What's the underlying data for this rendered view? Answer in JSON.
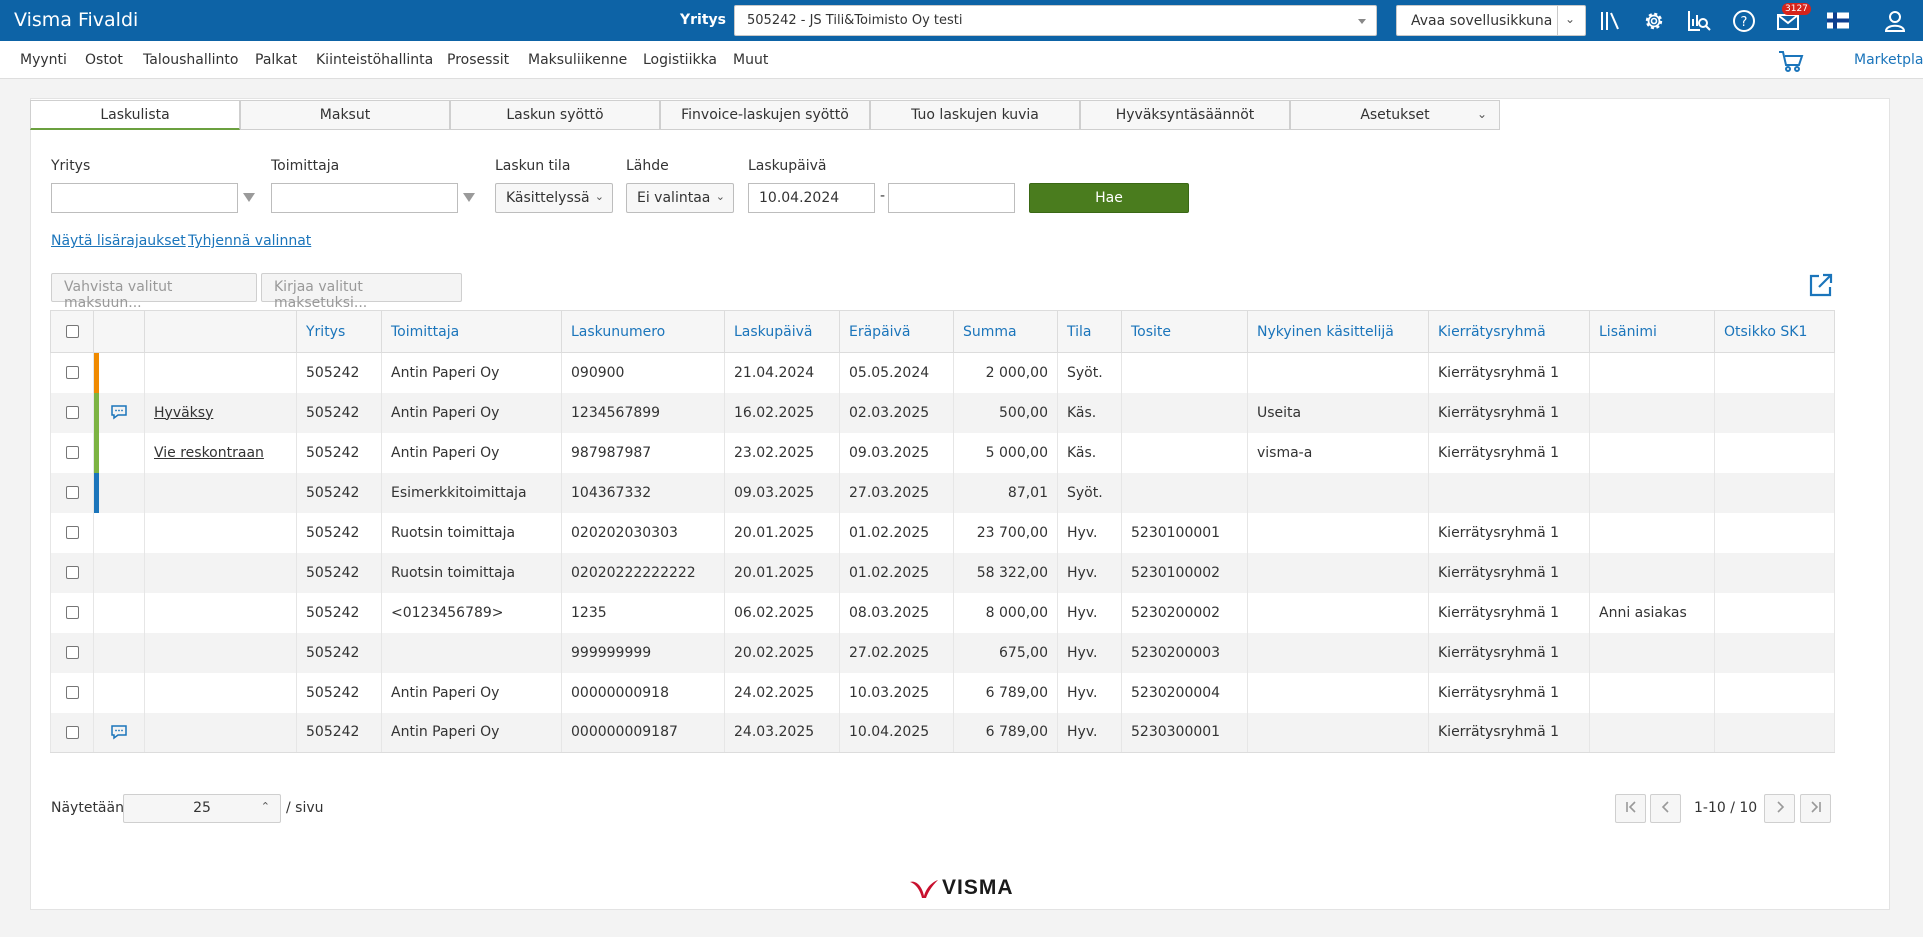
{
  "app": {
    "brand": "Visma Fivaldi",
    "company_label": "Yritys",
    "company_value": "505242 - JS Tili&Toimisto Oy testi",
    "open_app_label": "Avaa sovellusikkuna",
    "mail_count": "3127",
    "accent_color": "#0d63a6"
  },
  "menu": {
    "items": [
      "Myynti",
      "Ostot",
      "Taloushallinto",
      "Palkat",
      "Kiinteistöhallinta",
      "Prosessit",
      "Maksuliikenne",
      "Logistiikka",
      "Muut"
    ],
    "marketplace": "Marketplace"
  },
  "tabs": [
    "Laskulista",
    "Maksut",
    "Laskun syöttö",
    "Finvoice-laskujen syöttö",
    "Tuo laskujen kuvia",
    "Hyväksyntäsäännöt",
    "Asetukset"
  ],
  "filters": {
    "yritys_label": "Yritys",
    "yritys_value": "",
    "toimittaja_label": "Toimittaja",
    "toimittaja_value": "",
    "tila_label": "Laskun tila",
    "tila_value": "Käsittelyssä",
    "lahde_label": "Lähde",
    "lahde_value": "Ei valintaa",
    "laskupaiva_label": "Laskupäivä",
    "date_from": "10.04.2024",
    "date_sep": "-",
    "date_to": "",
    "search_button": "Hae",
    "more_limits": "Näytä lisärajaukset",
    "clear_selections": "Tyhjennä valinnat"
  },
  "actions": {
    "confirm_payment": "Vahvista valitut maksuun...",
    "record_payment": "Kirjaa valitut maksetuksi..."
  },
  "table": {
    "columns": [
      "Yritys",
      "Toimittaja",
      "Laskunumero",
      "Laskupäivä",
      "Eräpäivä",
      "Summa",
      "Tila",
      "Tosite",
      "Nykyinen käsittelijä",
      "Kierrätysryhmä",
      "Lisänimi",
      "Otsikko SK1"
    ],
    "rows": [
      {
        "status_color": "#f08a00",
        "comment": false,
        "action": "",
        "cells": [
          "505242",
          "Antin Paperi Oy",
          "090900",
          "21.04.2024",
          "05.05.2024",
          "2 000,00",
          "Syöt.",
          "",
          "",
          "Kierrätysryhmä 1",
          "",
          ""
        ]
      },
      {
        "status_color": "#7cb342",
        "comment": true,
        "action": "Hyväksy",
        "cells": [
          "505242",
          "Antin Paperi Oy",
          "1234567899",
          "16.02.2025",
          "02.03.2025",
          "500,00",
          "Käs.",
          "",
          "Useita",
          "Kierrätysryhmä 1",
          "",
          ""
        ]
      },
      {
        "status_color": "#7cb342",
        "comment": false,
        "action": "Vie reskontraan",
        "cells": [
          "505242",
          "Antin Paperi Oy",
          "987987987",
          "23.02.2025",
          "09.03.2025",
          "5 000,00",
          "Käs.",
          "",
          "visma-a",
          "Kierrätysryhmä 1",
          "",
          ""
        ]
      },
      {
        "status_color": "#1b75bb",
        "comment": false,
        "action": "",
        "cells": [
          "505242",
          "Esimerkkitoimittaja",
          "104367332",
          "09.03.2025",
          "27.03.2025",
          "87,01",
          "Syöt.",
          "",
          "",
          "",
          "",
          ""
        ]
      },
      {
        "status_color": "",
        "comment": false,
        "action": "",
        "cells": [
          "505242",
          "Ruotsin toimittaja",
          "020202030303",
          "20.01.2025",
          "01.02.2025",
          "23 700,00",
          "Hyv.",
          "5230100001",
          "",
          "Kierrätysryhmä 1",
          "",
          ""
        ]
      },
      {
        "status_color": "",
        "comment": false,
        "action": "",
        "cells": [
          "505242",
          "Ruotsin toimittaja",
          "02020222222222",
          "20.01.2025",
          "01.02.2025",
          "58 322,00",
          "Hyv.",
          "5230100002",
          "",
          "Kierrätysryhmä 1",
          "",
          ""
        ]
      },
      {
        "status_color": "",
        "comment": false,
        "action": "",
        "cells": [
          "505242",
          "<0123456789>",
          "1235",
          "06.02.2025",
          "08.03.2025",
          "8 000,00",
          "Hyv.",
          "5230200002",
          "",
          "Kierrätysryhmä 1",
          "Anni asiakas",
          ""
        ]
      },
      {
        "status_color": "",
        "comment": false,
        "action": "",
        "cells": [
          "505242",
          "",
          "999999999",
          "20.02.2025",
          "27.02.2025",
          "675,00",
          "Hyv.",
          "5230200003",
          "",
          "Kierrätysryhmä 1",
          "",
          ""
        ]
      },
      {
        "status_color": "",
        "comment": false,
        "action": "",
        "cells": [
          "505242",
          "Antin Paperi Oy",
          "00000000918",
          "24.02.2025",
          "10.03.2025",
          "6 789,00",
          "Hyv.",
          "5230200004",
          "",
          "Kierrätysryhmä 1",
          "",
          ""
        ]
      },
      {
        "status_color": "",
        "comment": true,
        "action": "",
        "cells": [
          "505242",
          "Antin Paperi Oy",
          "000000009187",
          "24.03.2025",
          "10.04.2025",
          "6 789,00",
          "Hyv.",
          "5230300001",
          "",
          "Kierrätysryhmä 1",
          "",
          ""
        ]
      }
    ]
  },
  "pager": {
    "showing_label": "Näytetään",
    "page_size": "25",
    "per_page_label": "/ sivu",
    "range": "1-10 / 10"
  },
  "footer": {
    "logo_text": "VISMA"
  }
}
